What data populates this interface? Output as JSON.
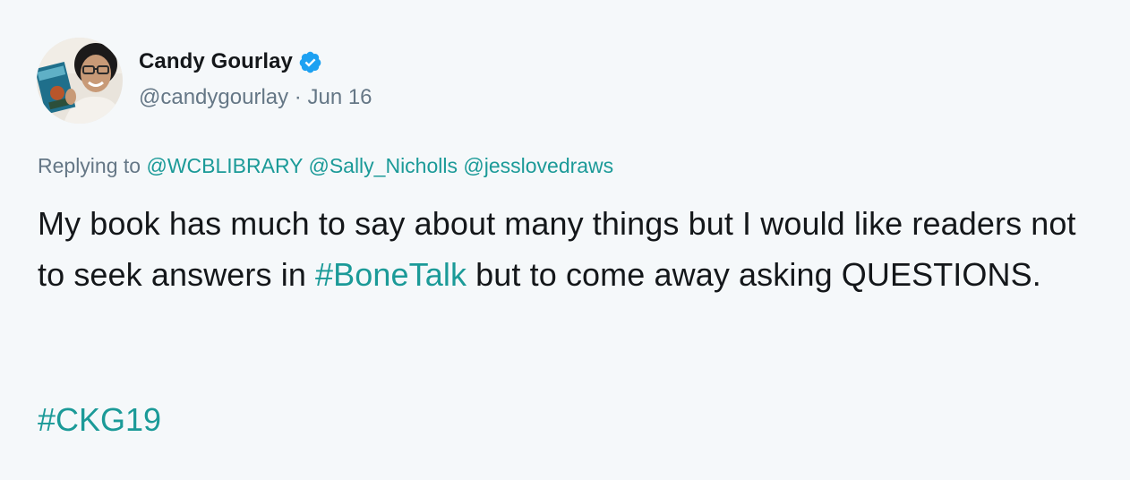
{
  "author": {
    "display_name": "Candy Gourlay",
    "handle": "@candygourlay",
    "separator": "·",
    "date": "Jun 16",
    "verified": true,
    "verified_icon": "verified-badge-icon",
    "avatar_icon": "avatar"
  },
  "reply": {
    "prefix": "Replying to",
    "mentions": [
      "@WCBLIBRARY",
      "@Sally_Nicholls",
      "@jesslovedraws"
    ]
  },
  "tweet": {
    "part1": "My book has much to say about many things but I would like readers not to seek answers in ",
    "hashtag1": "#BoneTalk",
    "part2": " but to come away asking QUESTIONS.",
    "hashtag2": "#CKG19"
  },
  "colors": {
    "background": "#f5f8fa",
    "text": "#14171a",
    "secondary": "#657786",
    "link": "#1b9a98",
    "verified": "#1da1f2"
  }
}
